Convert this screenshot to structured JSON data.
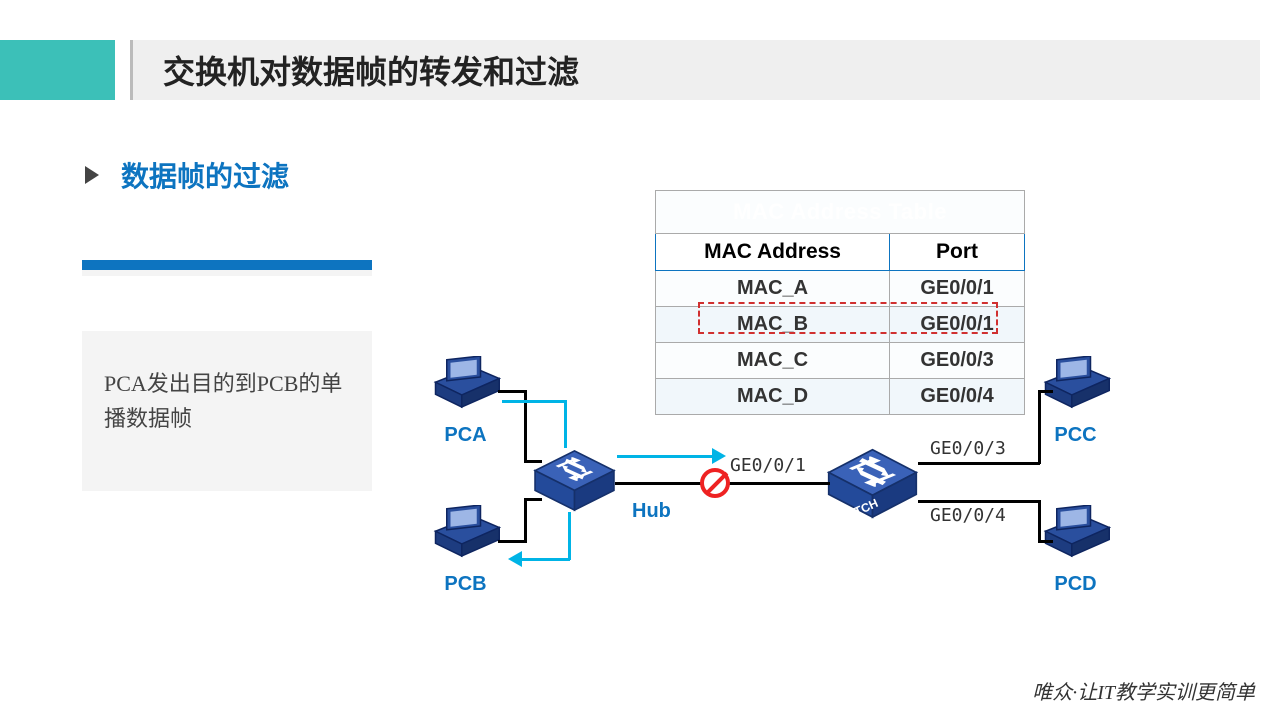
{
  "title": "交换机对数据帧的转发和过滤",
  "section": "数据帧的过滤",
  "note": "PCA发出目的到PCB的单播数据帧",
  "table": {
    "title": "MAC Address Table",
    "col1": "MAC Address",
    "col2": "Port",
    "rows": [
      {
        "mac": "MAC_A",
        "port": "GE0/0/1"
      },
      {
        "mac": "MAC_B",
        "port": "GE0/0/1"
      },
      {
        "mac": "MAC_C",
        "port": "GE0/0/3"
      },
      {
        "mac": "MAC_D",
        "port": "GE0/0/4"
      }
    ]
  },
  "devices": {
    "pca": "PCA",
    "pcb": "PCB",
    "pcc": "PCC",
    "pcd": "PCD",
    "hub": "Hub",
    "switch": "SWITCH"
  },
  "ports": {
    "p1": "GE0/0/1",
    "p3": "GE0/0/3",
    "p4": "GE0/0/4"
  },
  "footer": "唯众·让IT教学实训更简单",
  "colors": {
    "brand": "#0d74c0",
    "accent": "#3cc0b8"
  }
}
